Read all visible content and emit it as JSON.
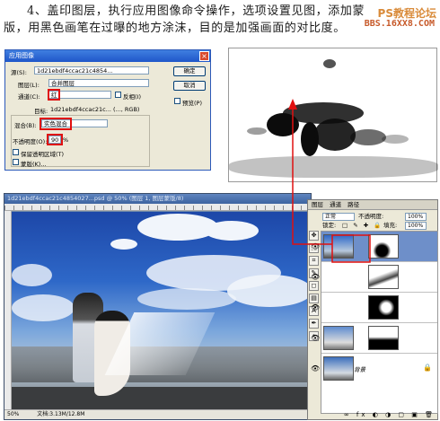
{
  "heading": {
    "line1": "4、盖印图层，执行应用图像命令操作，选项设置见图，添加蒙",
    "line2": "版，用黑色画笔在过曝的地方涂沫，目的是加强画面的对比度。"
  },
  "watermark": {
    "top": "PS教程论坛",
    "bottom": "BBS.16XX8.COM"
  },
  "dialog": {
    "title": "应用图像",
    "source_label": "源(S):",
    "source_value": "1d21ebdf4ccac21c4854...",
    "layer_label": "图层(L):",
    "layer_value": "合并图层",
    "channel_label": "通道(C):",
    "channel_value": "红",
    "invert_label": "反相(I)",
    "target_label": "目标:",
    "target_value": "1d21ebdf4ccac21c... (..., RGB)",
    "blending_label": "混合(B):",
    "blending_value": "实色混合",
    "opacity_label": "不透明度(O):",
    "opacity_value": "90",
    "opacity_unit": "%",
    "preserve_label": "保留透明区域(T)",
    "mask_label": "蒙版(K)...",
    "ok": "确定",
    "cancel": "取消",
    "preview": "预览(P)"
  },
  "ps_window": {
    "title": "1d21ebdf4ccac21c4854027...psd @ 50% (图层 1, 图层蒙版/8)",
    "zoom": "50%",
    "doc": "文档:3.13M/12.8M"
  },
  "layers_panel": {
    "tabs": [
      "图层",
      "通道",
      "路径"
    ],
    "blend": "正常",
    "opacity_label": "不透明度:",
    "opacity_value": "100%",
    "lock_label": "锁定:",
    "fill_label": "填充:",
    "fill_value": "100%",
    "background_name": "背景",
    "bottom_icons": "∞ fx ◐ ◑ ▢ ▣ 🗑"
  },
  "colors": {
    "accent_red": "#e01010",
    "titlebar_blue": "#2f6ad3",
    "layer_selected": "#6e8fc9"
  }
}
